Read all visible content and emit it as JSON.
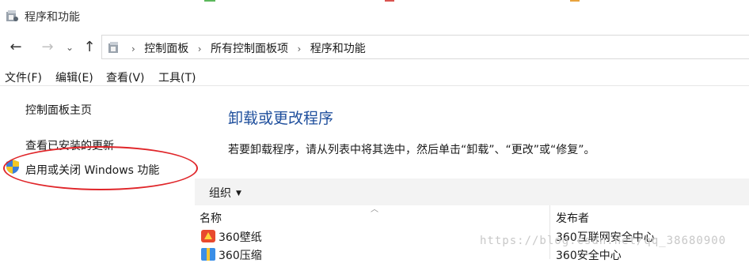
{
  "window": {
    "title": "程序和功能"
  },
  "address": {
    "crumbs": [
      "控制面板",
      "所有控制面板项",
      "程序和功能"
    ]
  },
  "menu": [
    "文件(F)",
    "编辑(E)",
    "查看(V)",
    "工具(T)"
  ],
  "left": {
    "home": "控制面板主页",
    "updates": "查看已安装的更新",
    "features": "启用或关闭 Windows 功能"
  },
  "main": {
    "title": "卸载或更改程序",
    "desc": "若要卸载程序，请从列表中将其选中，然后单击“卸载”、“更改”或“修复”。"
  },
  "toolbar": {
    "organize": "组织"
  },
  "table": {
    "col_name": "名称",
    "col_publisher": "发布者",
    "rows": [
      {
        "name": "360壁纸",
        "publisher": "360互联网安全中心"
      },
      {
        "name": "360压缩",
        "publisher": "360安全中心"
      }
    ]
  },
  "watermark": "https://blog.csdn.net/qq_38680900",
  "colors": {
    "accent": "#1e4e9c",
    "annotation": "#e0262a"
  }
}
